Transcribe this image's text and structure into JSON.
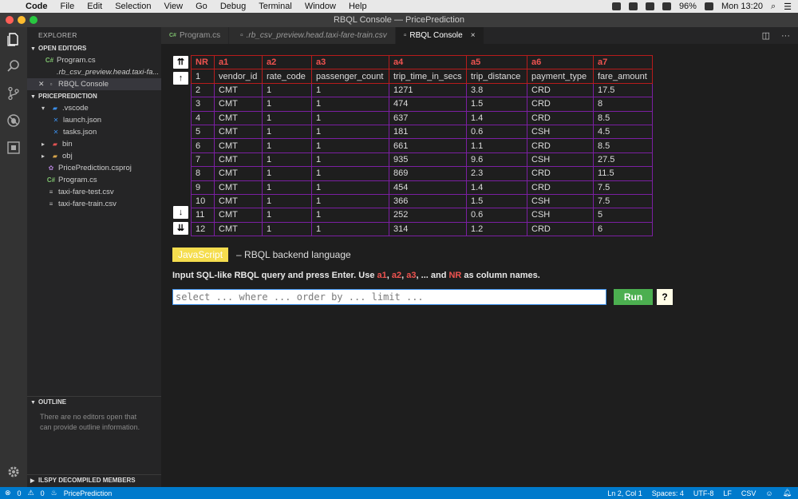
{
  "menubar": {
    "app": "Code",
    "items": [
      "File",
      "Edit",
      "Selection",
      "View",
      "Go",
      "Debug",
      "Terminal",
      "Window",
      "Help"
    ],
    "battery": "96%",
    "clock": "Mon 13:20"
  },
  "window": {
    "title": "RBQL Console — PricePrediction"
  },
  "sidebar": {
    "title": "EXPLORER",
    "open_editors_label": "OPEN EDITORS",
    "open_editors": [
      {
        "label": "Program.cs",
        "icon": "C#"
      },
      {
        "label": ".rb_csv_preview.head.taxi-fa...",
        "icon": ""
      },
      {
        "label": "RBQL Console",
        "icon": ""
      }
    ],
    "project_label": "PRICEPREDICTION",
    "tree": [
      {
        "label": ".vscode"
      },
      {
        "label": "launch.json"
      },
      {
        "label": "tasks.json"
      },
      {
        "label": "bin"
      },
      {
        "label": "obj"
      },
      {
        "label": "PricePrediction.csproj"
      },
      {
        "label": "Program.cs",
        "icon": "C#"
      },
      {
        "label": "taxi-fare-test.csv"
      },
      {
        "label": "taxi-fare-train.csv"
      }
    ],
    "outline_label": "OUTLINE",
    "outline_message": "There are no editors open that can provide outline information.",
    "ilspy_label": "ILSPY DECOMPILED MEMBERS"
  },
  "tabs": [
    {
      "label": "Program.cs",
      "icon": "C#"
    },
    {
      "label": ".rb_csv_preview.head.taxi-fare-train.csv"
    },
    {
      "label": "RBQL Console",
      "close": "×"
    }
  ],
  "nav": {
    "first": "⇈",
    "up": "↑",
    "down": "↓",
    "last": "⇊"
  },
  "table": {
    "headers": [
      "NR",
      "a1",
      "a2",
      "a3",
      "a4",
      "a5",
      "a6",
      "a7"
    ],
    "header_row": [
      "1",
      "vendor_id",
      "rate_code",
      "passenger_count",
      "trip_time_in_secs",
      "trip_distance",
      "payment_type",
      "fare_amount"
    ],
    "rows": [
      [
        "2",
        "CMT",
        "1",
        "1",
        "1271",
        "3.8",
        "CRD",
        "17.5"
      ],
      [
        "3",
        "CMT",
        "1",
        "1",
        "474",
        "1.5",
        "CRD",
        "8"
      ],
      [
        "4",
        "CMT",
        "1",
        "1",
        "637",
        "1.4",
        "CRD",
        "8.5"
      ],
      [
        "5",
        "CMT",
        "1",
        "1",
        "181",
        "0.6",
        "CSH",
        "4.5"
      ],
      [
        "6",
        "CMT",
        "1",
        "1",
        "661",
        "1.1",
        "CRD",
        "8.5"
      ],
      [
        "7",
        "CMT",
        "1",
        "1",
        "935",
        "9.6",
        "CSH",
        "27.5"
      ],
      [
        "8",
        "CMT",
        "1",
        "1",
        "869",
        "2.3",
        "CRD",
        "11.5"
      ],
      [
        "9",
        "CMT",
        "1",
        "1",
        "454",
        "1.4",
        "CRD",
        "7.5"
      ],
      [
        "10",
        "CMT",
        "1",
        "1",
        "366",
        "1.5",
        "CSH",
        "7.5"
      ],
      [
        "11",
        "CMT",
        "1",
        "1",
        "252",
        "0.6",
        "CSH",
        "5"
      ],
      [
        "12",
        "CMT",
        "1",
        "1",
        "314",
        "1.2",
        "CRD",
        "6"
      ]
    ]
  },
  "backend": {
    "button": "JavaScript",
    "text": "– RBQL backend language"
  },
  "hint": {
    "prefix": "Input SQL-like RBQL query and press Enter. Use ",
    "a1": "a1",
    "sep1": ", ",
    "a2": "a2",
    "sep2": ", ",
    "a3": "a3",
    "middle": ", ... and ",
    "nr": "NR",
    "suffix": " as column names."
  },
  "query": {
    "placeholder": "select ... where ... order by ... limit ...",
    "value": ""
  },
  "run_label": "Run",
  "help_label": "?",
  "statusbar": {
    "errors": "0",
    "warnings": "0",
    "project": "PricePrediction",
    "position": "Ln 2, Col 1",
    "spaces": "Spaces: 4",
    "encoding": "UTF-8",
    "eol": "LF",
    "language": "CSV"
  },
  "colors": {
    "accent": "#007acc",
    "header_red": "#ef5350",
    "body_border": "#7b1fa2",
    "run_green": "#4caf50",
    "js_yellow": "#f5dd4e"
  }
}
